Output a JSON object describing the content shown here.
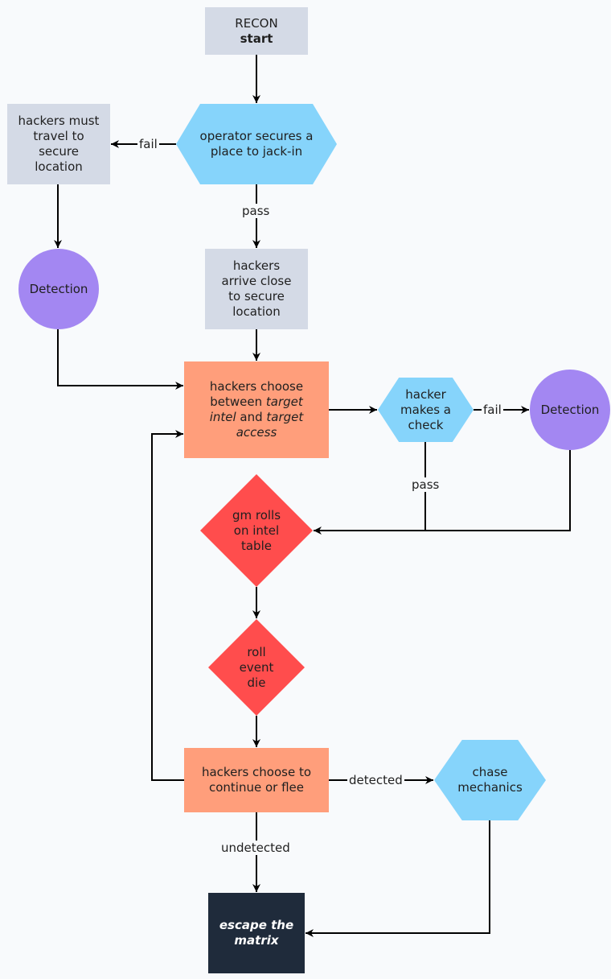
{
  "colors": {
    "background": "#f8fafc",
    "process_gray": "#d4dae6",
    "decision_blue": "#86d4fb",
    "detection_purple": "#a387f2",
    "choice_orange": "#ff9e7b",
    "gm_red": "#ff4d4d",
    "end_dark": "#1f2b3b"
  },
  "nodes": {
    "recon_start": {
      "line1": "RECON",
      "line2": "start"
    },
    "travel": {
      "text": "hackers must\ntravel to\nsecure\nlocation"
    },
    "jack_in": {
      "text": "operator secures a\nplace to jack-in"
    },
    "detection_left": {
      "text": "Detection"
    },
    "arrive": {
      "text": "hackers\narrive close\nto secure\nlocation"
    },
    "choose_target": {
      "part1": "hackers choose\nbetween ",
      "italic1": "target\nintel",
      "part2": " and ",
      "italic2": "target\naccess"
    },
    "make_check": {
      "text": "hacker\nmakes a\ncheck"
    },
    "detection_right": {
      "text": "Detection"
    },
    "gm_rolls": {
      "text": "gm rolls\non intel\ntable"
    },
    "event_die": {
      "text": "roll\nevent\ndie"
    },
    "continue_flee": {
      "text": "hackers choose to\ncontinue or flee"
    },
    "chase": {
      "text": "chase\nmechanics"
    },
    "escape": {
      "text": "escape the\nmatrix"
    }
  },
  "edge_labels": {
    "fail_left": "fail",
    "pass_top": "pass",
    "fail_right": "fail",
    "pass_check": "pass",
    "detected": "detected",
    "undetected": "undetected"
  }
}
